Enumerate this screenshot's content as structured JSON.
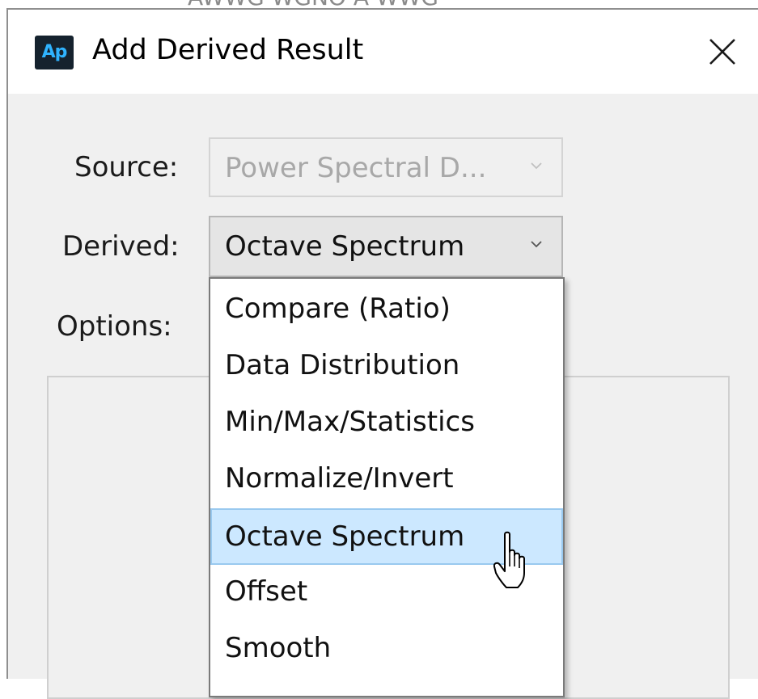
{
  "window": {
    "title": "Add Derived Result",
    "app_icon_text": "Ap",
    "close_icon": "close-icon",
    "background_peek_text": "AWWG  WGNO  A WWG"
  },
  "form": {
    "source_label": "Source:",
    "source_value": "Power Spectral D...",
    "derived_label": "Derived:",
    "derived_value": "Octave Spectrum",
    "options_label": "Options:"
  },
  "dropdown": {
    "items": [
      "Compare (Ratio)",
      "Data Distribution",
      "Min/Max/Statistics",
      "Normalize/Invert",
      "Octave Spectrum",
      "Offset",
      "Smooth"
    ],
    "selected": "Octave Spectrum"
  },
  "colors": {
    "selection_fill": "#cce8ff",
    "selection_border": "#99c9ef",
    "app_icon_bg": "#15222e",
    "app_icon_fg": "#2fb3ff"
  }
}
